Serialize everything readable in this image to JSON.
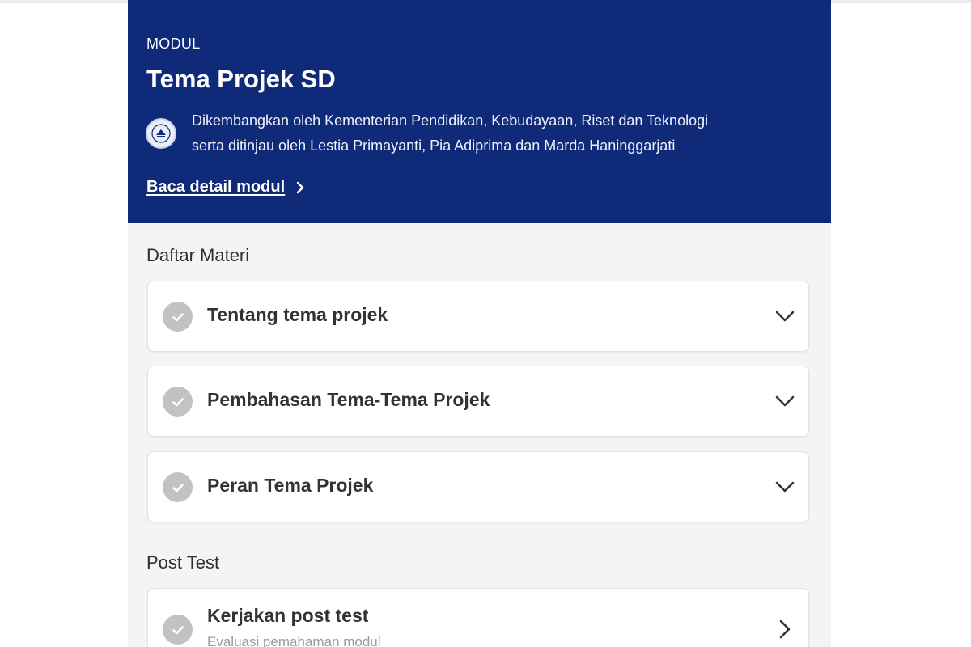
{
  "module": {
    "overline": "MODUL",
    "title": "Tema Projek SD",
    "credit_line1": "Dikembangkan oleh Kementerian Pendidikan, Kebudayaan, Riset dan Teknologi",
    "credit_line2": "serta ditinjau oleh Lestia Primayanti, Pia Adiprima dan Marda Haninggarjati",
    "detail_link": "Baca detail modul",
    "logo_icon": "kemendikbud-seal-icon"
  },
  "materials": {
    "heading": "Daftar Materi",
    "items": [
      {
        "label": "Tentang tema projek",
        "status_icon": "check-circle-icon",
        "action_icon": "chevron-down-icon"
      },
      {
        "label": "Pembahasan Tema-Tema Projek",
        "status_icon": "check-circle-icon",
        "action_icon": "chevron-down-icon"
      },
      {
        "label": "Peran Tema Projek",
        "status_icon": "check-circle-icon",
        "action_icon": "chevron-down-icon"
      }
    ]
  },
  "post_test": {
    "heading": "Post Test",
    "item": {
      "label": "Kerjakan post test",
      "subtitle": "Evaluasi pemahaman modul",
      "status_icon": "check-circle-icon",
      "action_icon": "chevron-right-icon"
    }
  },
  "colors": {
    "header_bg": "#0f2a78",
    "page_bg": "#f4f4f4",
    "check_gray": "#c2c2c2"
  }
}
